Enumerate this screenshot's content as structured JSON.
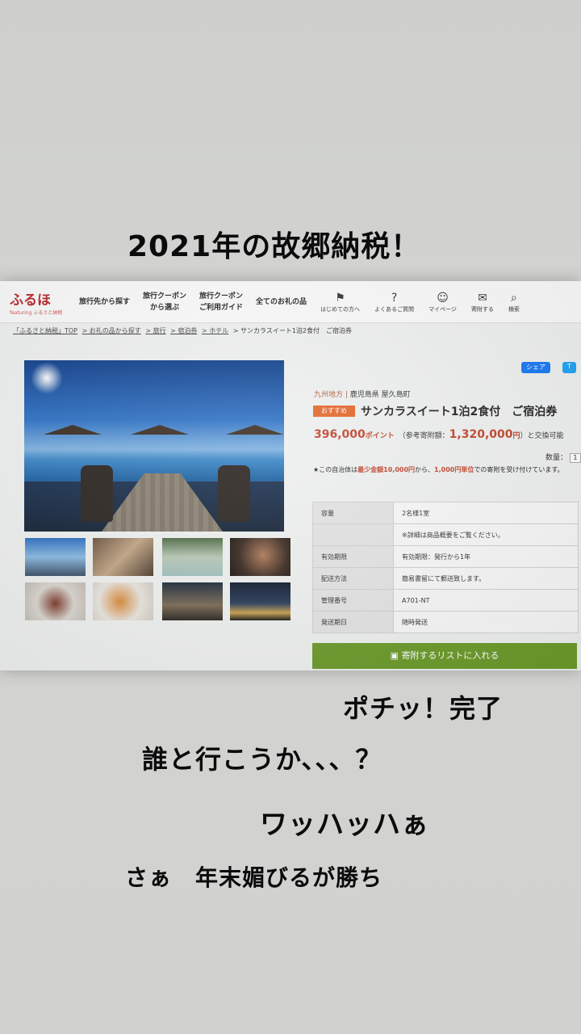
{
  "captions": {
    "title": "2021年の故郷納税！",
    "line1": "ポチッ！完了",
    "line2": "誰と行こうか、、、？",
    "line3": "ワッハッハぁ",
    "line4": "さぁ　年末媚びるが勝ち"
  },
  "site": {
    "logo": "ふるほ",
    "logo_sub": "featuring ふるさと納税",
    "nav": [
      "旅行先から探す",
      "旅行クーポン\nから選ぶ",
      "旅行クーポン\nご利用ガイド",
      "全てのお礼の品"
    ],
    "icons": [
      {
        "label": "はじめての方へ",
        "glyph": "⚑",
        "name": "beginner-icon"
      },
      {
        "label": "よくあるご質問",
        "glyph": "?",
        "name": "faq-icon"
      },
      {
        "label": "マイページ",
        "glyph": "☺",
        "name": "user-icon"
      },
      {
        "label": "寄附する",
        "glyph": "✉",
        "name": "donate-icon"
      },
      {
        "label": "検索",
        "glyph": "⌕",
        "name": "search-icon"
      }
    ],
    "breadcrumb": [
      "「ふるさと納税」TOP",
      "> お礼の品から探す",
      "> 旅行",
      "> 宿泊券",
      "> ホテル",
      "> サンカラスイート1泊2食付　ご宿泊券"
    ]
  },
  "product": {
    "share_fb": "シェア",
    "share_tw": "T",
    "region": "九州地方",
    "prefecture": "鹿児島県 屋久島町",
    "badge": "おすすめ",
    "title": "サンカラスイート1泊2食付　ご宿泊券",
    "points": "396,000",
    "points_unit": "ポイント",
    "ref_label": "（参考寄附額：",
    "ref_amount": "1,320,000",
    "ref_unit": "円",
    "exchange": "）と交換可能",
    "qty_label": "数量：",
    "qty_value": "1",
    "note_a": "★この自治体は",
    "note_b": "最少金額10,000円",
    "note_c": "から、",
    "note_d": "1,000円単位",
    "note_e": "での寄附を受け付けています。",
    "specs": [
      {
        "k": "容量",
        "v": "2名様1室"
      },
      {
        "k": "",
        "v": "※詳細は商品概要をご覧ください。"
      },
      {
        "k": "有効期限",
        "v": "有効期限：発行から1年"
      },
      {
        "k": "配送方法",
        "v": "簡易書留にて郵送致します。"
      },
      {
        "k": "管理番号",
        "v": "A701-NT"
      },
      {
        "k": "発送期日",
        "v": "随時発送"
      }
    ],
    "cart_label": "寄附するリストに入れる"
  },
  "colors": {
    "accent": "#c1432b",
    "cart": "#6b9a2a",
    "badge": "#e3672a"
  }
}
